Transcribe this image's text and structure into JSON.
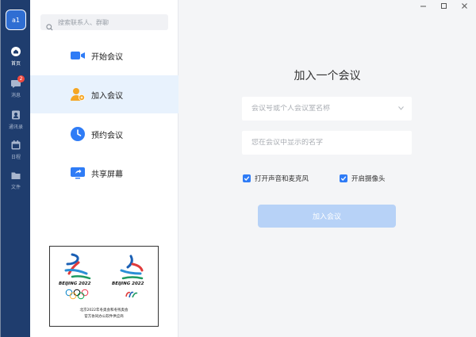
{
  "rail": {
    "avatar_text": "a1",
    "items": [
      {
        "label": "首页",
        "icon": "home-icon",
        "active": true
      },
      {
        "label": "消息",
        "icon": "chat-icon",
        "badge": "2"
      },
      {
        "label": "通讯录",
        "icon": "contacts-icon"
      },
      {
        "label": "日程",
        "icon": "calendar-icon"
      },
      {
        "label": "文件",
        "icon": "folder-icon"
      }
    ]
  },
  "search": {
    "placeholder": "搜索联系人、群聊"
  },
  "menu": {
    "items": [
      {
        "label": "开始会议",
        "icon": "video-camera-icon"
      },
      {
        "label": "加入会议",
        "icon": "join-user-icon",
        "active": true
      },
      {
        "label": "预约会议",
        "icon": "clock-icon"
      },
      {
        "label": "共享屏幕",
        "icon": "share-screen-icon"
      }
    ]
  },
  "logo_card": {
    "left_wordmark": "BEIJING 2022",
    "right_wordmark": "BEIJING 2022",
    "line1": "北京2022年冬奥会和冬残奥会",
    "line2": "官方协同办公软件供应商"
  },
  "join": {
    "title": "加入一个会议",
    "meeting_id_placeholder": "会议号或个人会议室名称",
    "name_placeholder": "您在会议中显示的名字",
    "audio_label": "打开声音和麦克风",
    "camera_label": "开启摄像头",
    "audio_checked": true,
    "camera_checked": true,
    "button_label": "加入会议"
  },
  "colors": {
    "rail_bg": "#1f3d6e",
    "accent": "#2f7cf6",
    "active_item_bg": "#e8f2fd",
    "join_button": "#b7d2f7"
  }
}
